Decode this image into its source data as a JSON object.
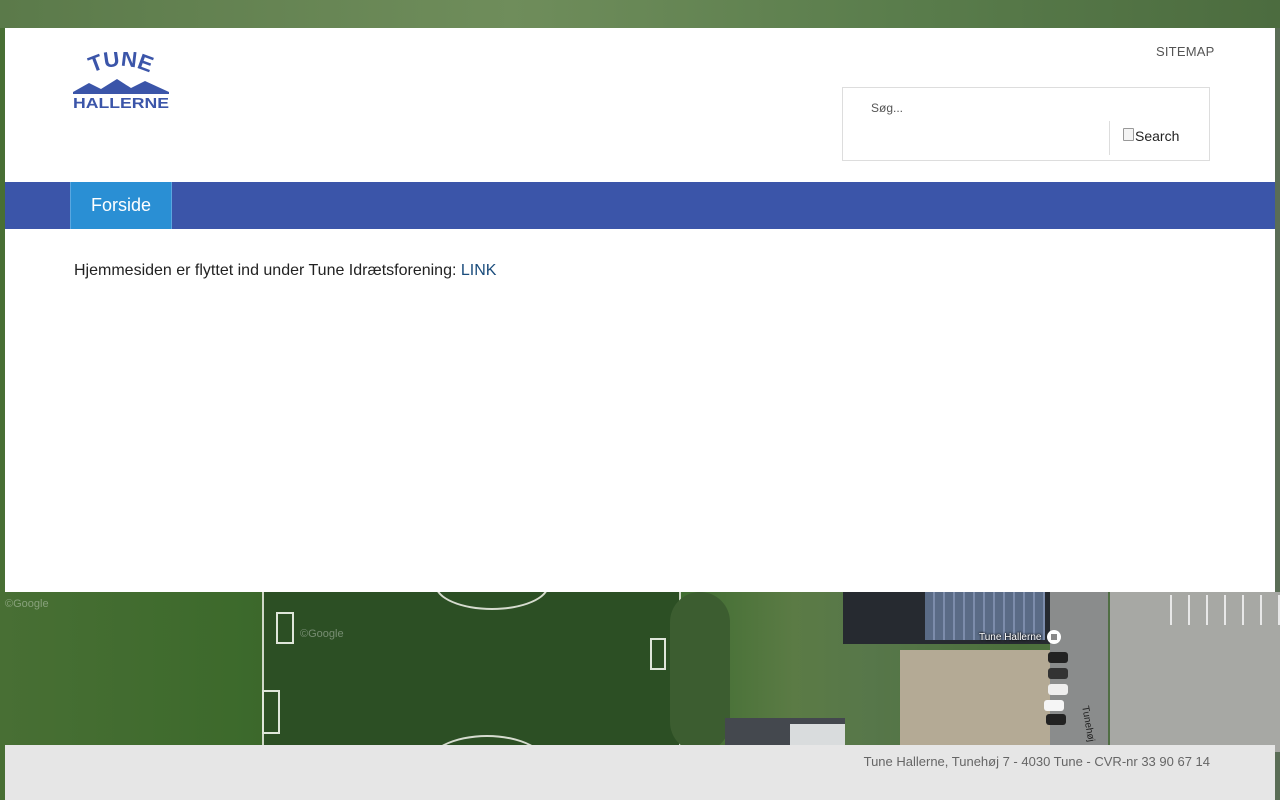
{
  "header": {
    "logo": {
      "line1": "TUNE",
      "line2": "HALLERNE",
      "color": "#3b55a9"
    },
    "sitemap_label": "SITEMAP"
  },
  "search": {
    "placeholder": "Søg...",
    "button_label": "Search",
    "button_icon": "broken-image-icon"
  },
  "nav": {
    "tabs": [
      {
        "label": "Forside",
        "active": true
      }
    ],
    "bar_color": "#3b55a9",
    "active_color": "#2a8fd4"
  },
  "content": {
    "text": "Hjemmesiden er flyttet ind under Tune Idrætsforening: ",
    "link_label": "LINK"
  },
  "map": {
    "marker_label": "Tune Hallerne",
    "road_label": "Tunehøj",
    "watermark": "©Google"
  },
  "footer": {
    "text": "Tune Hallerne, Tunehøj 7 - 4030 Tune - CVR-nr 33 90 67 14"
  }
}
